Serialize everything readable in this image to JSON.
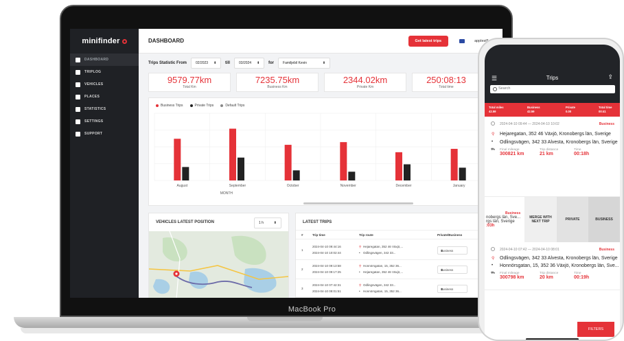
{
  "laptop": {
    "model_label": "MacBook Pro",
    "logo": "minifinder",
    "nav": [
      {
        "label": "DASHBOARD",
        "icon": "home-icon",
        "active": true
      },
      {
        "label": "TRIPLOG",
        "icon": "car-icon"
      },
      {
        "label": "VEHICLES",
        "icon": "vehicle-icon"
      },
      {
        "label": "PLACES",
        "icon": "map-icon"
      },
      {
        "label": "STATISTICS",
        "icon": "chart-icon"
      },
      {
        "label": "SETTINGS",
        "icon": "gear-icon"
      },
      {
        "label": "SUPPORT",
        "icon": "globe-icon"
      }
    ],
    "header": {
      "title": "DASHBOARD",
      "get_trips": "Get latest trips",
      "user": "applest5"
    },
    "filters": {
      "label": "Trips Statistic From",
      "from": "02/2023",
      "till_label": "till",
      "till": "03/2024",
      "for_label": "for",
      "vehicle": "Familjebil Kevin"
    },
    "stats": [
      {
        "value": "9579.77km",
        "label": "Total Km"
      },
      {
        "value": "7235.75km",
        "label": "Business Km"
      },
      {
        "value": "2344.02km",
        "label": "Private Km"
      },
      {
        "value": "250:08:13",
        "label": "Total time"
      }
    ],
    "chart_legend": [
      "Business Trips",
      "Private Trips",
      "Default Trips"
    ],
    "vehicles_card": {
      "title": "VEHICLES LATEST POSITION",
      "select": "1 h"
    },
    "latest_trips": {
      "title": "LATEST TRIPS",
      "headers": [
        "#",
        "Trip time",
        "Trip route",
        "Private/Business"
      ],
      "rows": [
        {
          "n": "1",
          "t1": "2024-04-10 09:44:16",
          "t2": "2024-04-10 10:02:44",
          "r1": "Hejaregatan, 352 46 Växjö,...",
          "r2": "Odlingsvägen, 342 33...",
          "type": "Business"
        },
        {
          "n": "2",
          "t1": "2024-04-10 09:13:58",
          "t2": "2024-04-10 09:17:25",
          "r1": "Honnörsgatan, 15, 352 36...",
          "r2": "Hejaregatan, 352 46 Växjö,...",
          "type": "Business"
        },
        {
          "n": "3",
          "t1": "2024-04-10 07:42:31",
          "t2": "2024-04-10 08:01:51",
          "r1": "Odlingsvägen, 342 33...",
          "r2": "Honnörsgatan, 15, 352 36...",
          "type": "Business"
        }
      ]
    }
  },
  "chart_data": {
    "type": "bar",
    "categories": [
      "August",
      "September",
      "October",
      "November",
      "December",
      "January"
    ],
    "xlabel": "MONTH",
    "series": [
      {
        "name": "Business Trips",
        "color": "#e53238",
        "values": [
          62,
          77,
          53,
          57,
          42,
          47
        ]
      },
      {
        "name": "Private Trips",
        "color": "#222222",
        "values": [
          20,
          34,
          15,
          13,
          24,
          19
        ]
      }
    ],
    "ylim": [
      0,
      100
    ],
    "grid": true
  },
  "phone": {
    "title": "Trips",
    "search_placeholder": "Search",
    "summary": [
      {
        "label": "Total miles",
        "value": "42.59"
      },
      {
        "label": "Business",
        "value": "42.59"
      },
      {
        "label": "Private",
        "value": "0.00"
      },
      {
        "label": "Total time",
        "value": "00:41"
      }
    ],
    "trips": [
      {
        "time": "2024-04-10 09:44 — 2024-04-10 10:02",
        "tag": "Business",
        "from": "Hejaregatan, 352 46 Växjö, Kronobergs län, Sverige",
        "to": "Odlingsvägen, 342 33 Alvesta, Kronobergs län, Sverige",
        "mileage_label": "Final mileage",
        "mileage": "300821 km",
        "distance_label": "Trip distance",
        "distance": "21 km",
        "time_label": "Time",
        "duration": "00:18h"
      },
      {
        "time": "2024-04-10 07:42 — 2024-04-10 08:01",
        "tag": "Business",
        "from": "Odlingsvägen, 342 33 Alvesta, Kronobergs län, Sverige",
        "to": "Honnörsgatan, 15, 352 36 Växjö, Kronobergs län, Sve...",
        "mileage_label": "Final mileage",
        "mileage": "300798 km",
        "distance_label": "Trip distance",
        "distance": "20 km",
        "time_label": "Time",
        "duration": "00:19h"
      }
    ],
    "swipe": {
      "tag": "Business",
      "addr1": "nobergs län, Sve...",
      "addr2": "rgs län, Sverige",
      "time": ":03h",
      "merge": "MERGE WITH NEXT TRIP",
      "private": "PRIVATE",
      "business": "BUSINESS"
    },
    "filters_button": "FILTERS"
  }
}
